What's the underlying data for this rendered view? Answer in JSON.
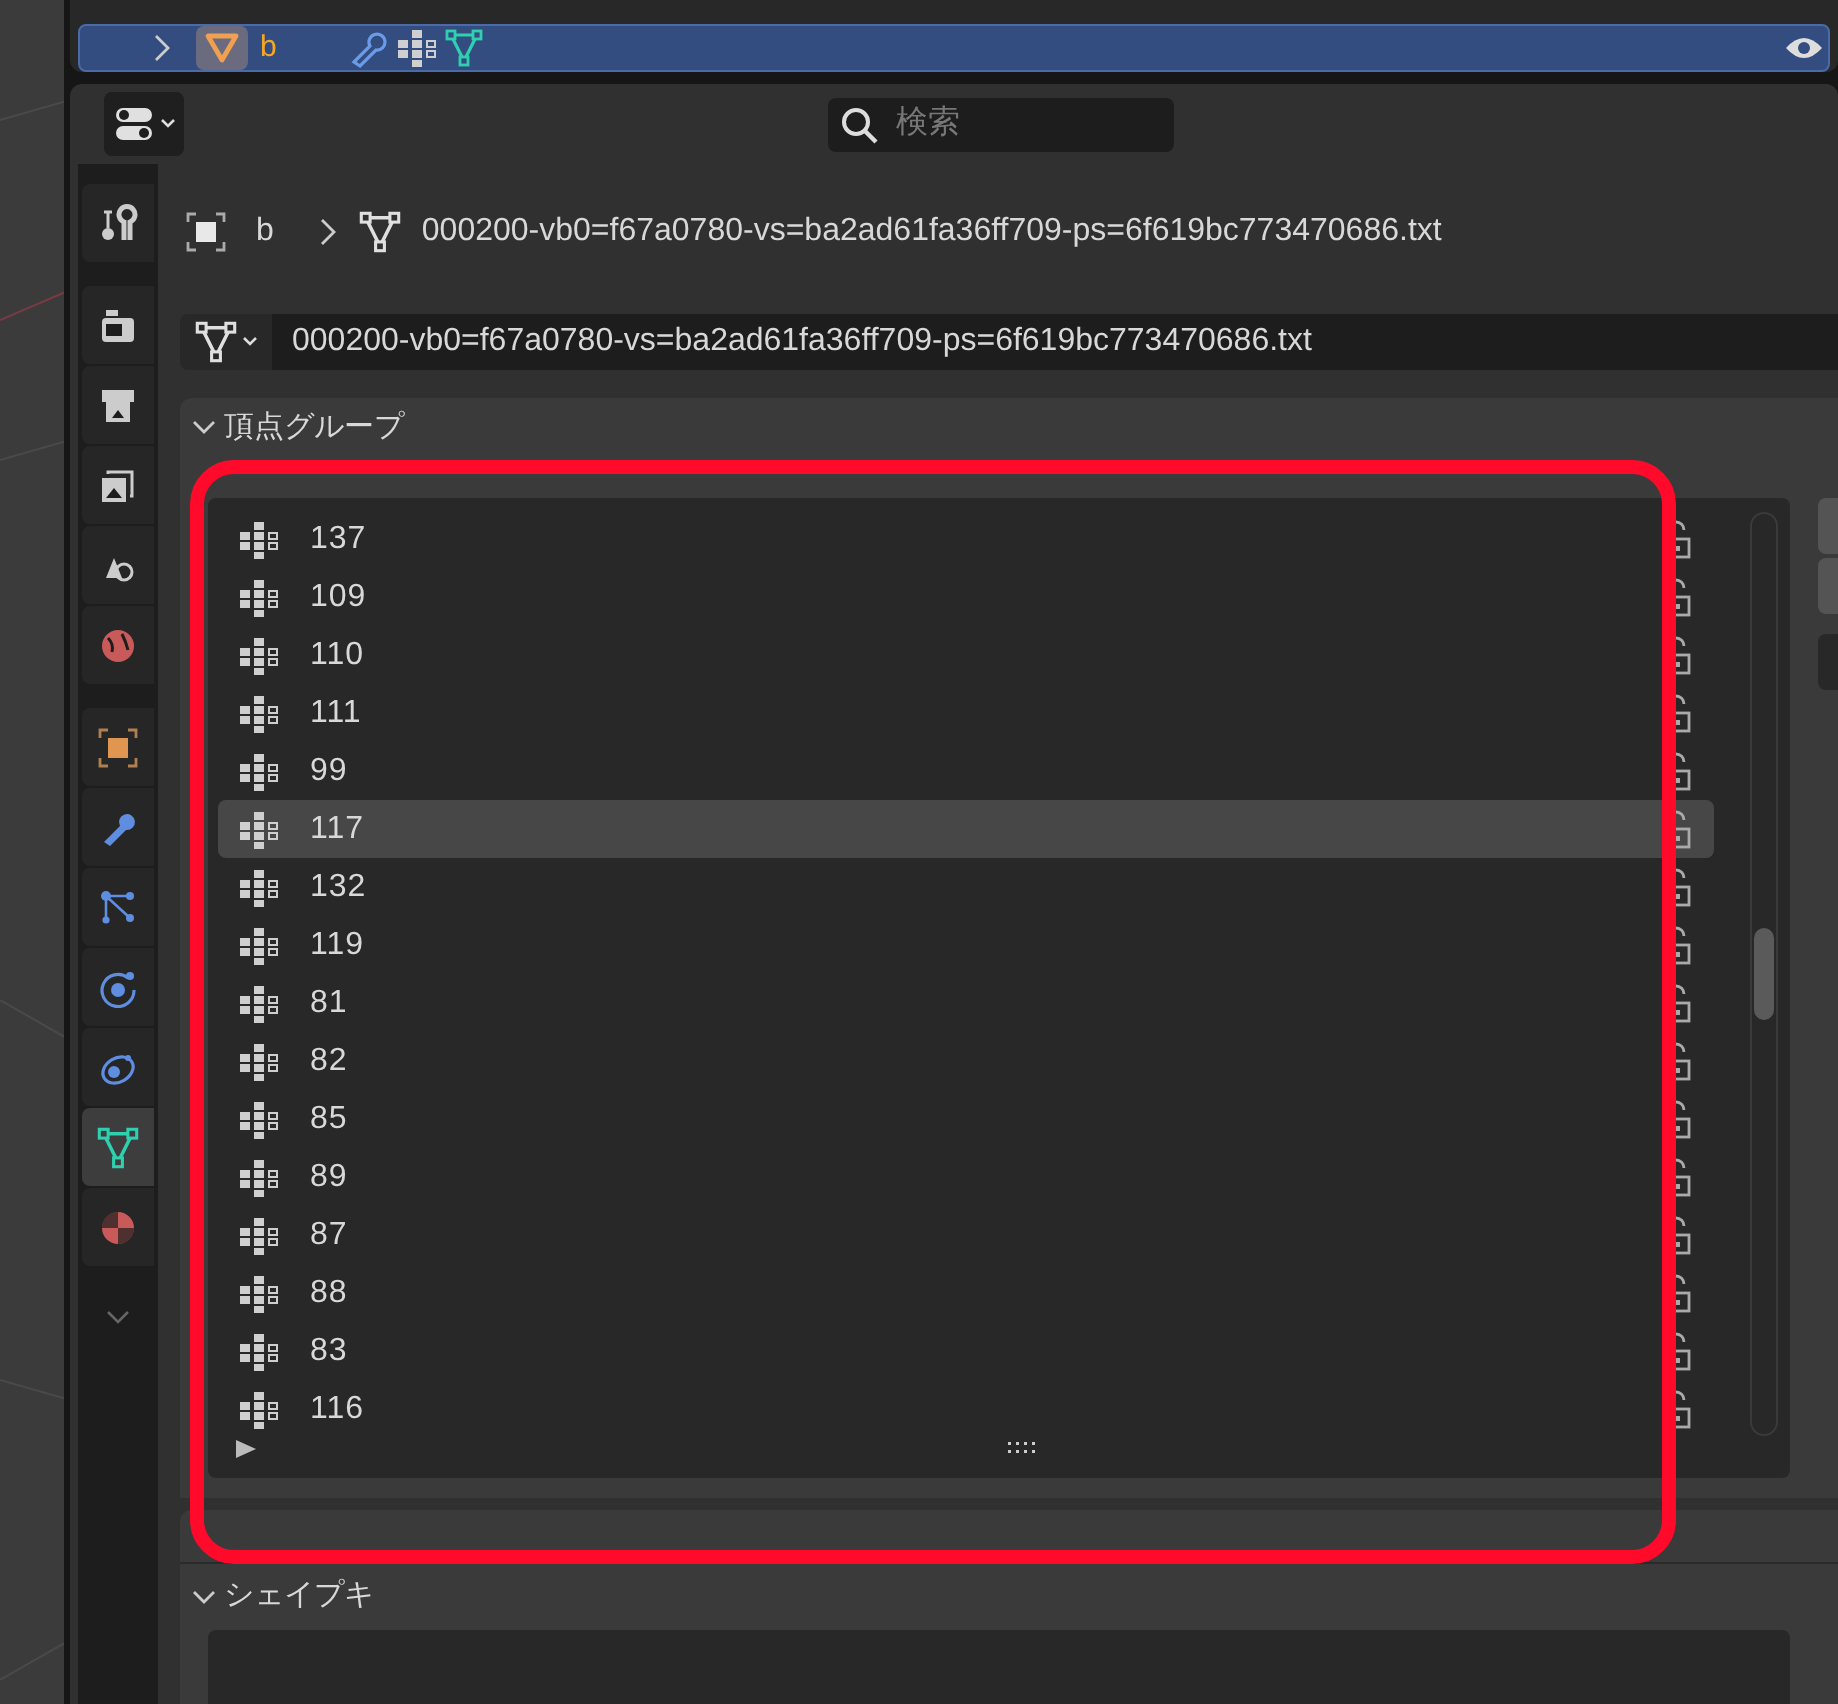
{
  "outliner": {
    "row": {
      "name": "b",
      "selected": true,
      "expanded": false
    }
  },
  "properties": {
    "search": {
      "placeholder": "検索"
    },
    "tab_groups": [
      [
        {
          "kind": "tool",
          "selected": false
        }
      ],
      [
        {
          "kind": "render",
          "selected": false
        },
        {
          "kind": "output",
          "selected": false
        },
        {
          "kind": "view_layer",
          "selected": false
        },
        {
          "kind": "scene",
          "selected": false
        },
        {
          "kind": "world",
          "selected": false
        }
      ],
      [
        {
          "kind": "object",
          "selected": false
        },
        {
          "kind": "modifiers",
          "selected": false
        },
        {
          "kind": "particles",
          "selected": false
        },
        {
          "kind": "physics",
          "selected": false
        },
        {
          "kind": "constraints",
          "selected": false
        },
        {
          "kind": "data",
          "selected": true
        },
        {
          "kind": "material",
          "selected": false
        }
      ]
    ],
    "breadcrumb": {
      "object": "b",
      "mesh": "000200-vb0=f67a0780-vs=ba2ad61fa36ff709-ps=6f619bc773470686.txt"
    },
    "mesh_datablock": {
      "value": "000200-vb0=f67a0780-vs=ba2ad61fa36ff709-ps=6f619bc773470686.txt"
    },
    "vertex_groups": {
      "title": "頂点グループ",
      "expanded": true,
      "items": [
        {
          "name": "137",
          "selected": false,
          "locked": false
        },
        {
          "name": "109",
          "selected": false,
          "locked": false
        },
        {
          "name": "110",
          "selected": false,
          "locked": false
        },
        {
          "name": "111",
          "selected": false,
          "locked": false
        },
        {
          "name": "99",
          "selected": false,
          "locked": false
        },
        {
          "name": "117",
          "selected": true,
          "locked": false
        },
        {
          "name": "132",
          "selected": false,
          "locked": false
        },
        {
          "name": "119",
          "selected": false,
          "locked": false
        },
        {
          "name": "81",
          "selected": false,
          "locked": false
        },
        {
          "name": "82",
          "selected": false,
          "locked": false
        },
        {
          "name": "85",
          "selected": false,
          "locked": false
        },
        {
          "name": "89",
          "selected": false,
          "locked": false
        },
        {
          "name": "87",
          "selected": false,
          "locked": false
        },
        {
          "name": "88",
          "selected": false,
          "locked": false
        },
        {
          "name": "83",
          "selected": false,
          "locked": false
        },
        {
          "name": "116",
          "selected": false,
          "locked": false
        }
      ]
    },
    "shape_keys": {
      "title": "シェイプキ"
    }
  }
}
